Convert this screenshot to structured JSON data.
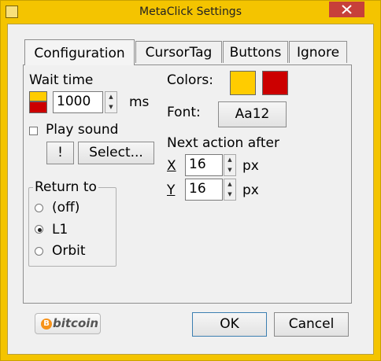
{
  "window": {
    "title": "MetaClick Settings"
  },
  "tabs": [
    "Configuration",
    "CursorTag",
    "Buttons",
    "Ignore"
  ],
  "wait": {
    "label": "Wait time",
    "value": "1000",
    "unit": "ms"
  },
  "sound": {
    "label": "Play sound",
    "test_label": "!",
    "select_label": "Select...",
    "checked": false
  },
  "return_to": {
    "label": "Return to",
    "options": [
      "(off)",
      "L1",
      "Orbit"
    ],
    "selected": "L1"
  },
  "colors": {
    "label": "Colors:",
    "primary": "#ffcc00",
    "secondary": "#cc0000"
  },
  "font": {
    "label": "Font:",
    "button_label": "Aa12"
  },
  "next_action": {
    "label": "Next action after",
    "x_label": "X",
    "x_value": "16",
    "y_label": "Y",
    "y_value": "16",
    "unit": "px"
  },
  "footer": {
    "bitcoin_label": "bitcoin",
    "ok_label": "OK",
    "cancel_label": "Cancel"
  }
}
